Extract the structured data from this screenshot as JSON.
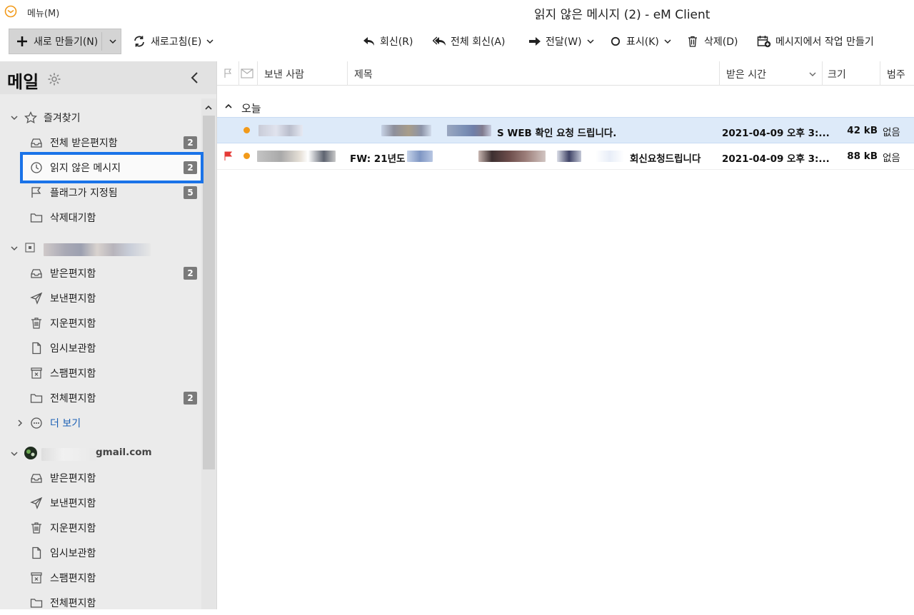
{
  "titlebar": {
    "menu": "메뉴(M)",
    "window_title": "읽지 않은 메시지 (2) - eM Client"
  },
  "toolbar": {
    "new": "새로 만들기(N)",
    "refresh": "새로고침(E)",
    "reply": "회신(R)",
    "reply_all": "전체 회신(A)",
    "forward": "전달(W)",
    "mark": "표시(K)",
    "delete": "삭제(D)",
    "create_task": "메시지에서 작업 만들기"
  },
  "sidebar": {
    "title": "메일",
    "favorites": {
      "label": "즐겨찾기",
      "items": [
        {
          "label": "전체 받은편지함",
          "badge": "2",
          "icon": "inbox-icon"
        },
        {
          "label": "읽지 않은 메시지",
          "badge": "2",
          "icon": "clock-icon"
        },
        {
          "label": "플래그가 지정됨",
          "badge": "5",
          "icon": "flag-icon"
        },
        {
          "label": "삭제대기함",
          "badge": "",
          "icon": "folder-icon"
        }
      ]
    },
    "account1": {
      "items": [
        {
          "label": "받은편지함",
          "badge": "2",
          "icon": "inbox-icon"
        },
        {
          "label": "보낸편지함",
          "badge": "",
          "icon": "send-icon"
        },
        {
          "label": "지운편지함",
          "badge": "",
          "icon": "trash-icon"
        },
        {
          "label": "임시보관함",
          "badge": "",
          "icon": "draft-icon"
        },
        {
          "label": "스팸편지함",
          "badge": "",
          "icon": "spam-icon"
        },
        {
          "label": "전체편지함",
          "badge": "2",
          "icon": "folder-icon"
        }
      ],
      "more": "더 보기"
    },
    "account2": {
      "label": "gmail.com",
      "items": [
        {
          "label": "받은편지함",
          "icon": "inbox-icon"
        },
        {
          "label": "보낸편지함",
          "icon": "send-icon"
        },
        {
          "label": "지운편지함",
          "icon": "trash-icon"
        },
        {
          "label": "임시보관함",
          "icon": "draft-icon"
        },
        {
          "label": "스팸편지함",
          "icon": "spam-icon"
        },
        {
          "label": "전체편지함",
          "icon": "folder-icon"
        }
      ]
    }
  },
  "list": {
    "columns": {
      "from": "보낸 사람",
      "subject": "제목",
      "received": "받은 시간",
      "size": "크기",
      "category": "범주"
    },
    "group": "오늘",
    "messages": [
      {
        "subject": "S WEB 확인 요청 드립니다.",
        "date": "2021-04-09 오후 3:...",
        "size": "42 kB",
        "category": "없음",
        "flagged": false,
        "unread": true
      },
      {
        "subject_prefix": "FW: 21년도",
        "subject": "회신요청드립니다",
        "date": "2021-04-09 오후 3:...",
        "size": "88 kB",
        "category": "없음",
        "flagged": true,
        "unread": true
      }
    ]
  },
  "colors": {
    "accent": "#1a73e8",
    "unread_dot": "#f29a1a",
    "flag": "#e53935",
    "selected_row": "#ddeaf9"
  }
}
